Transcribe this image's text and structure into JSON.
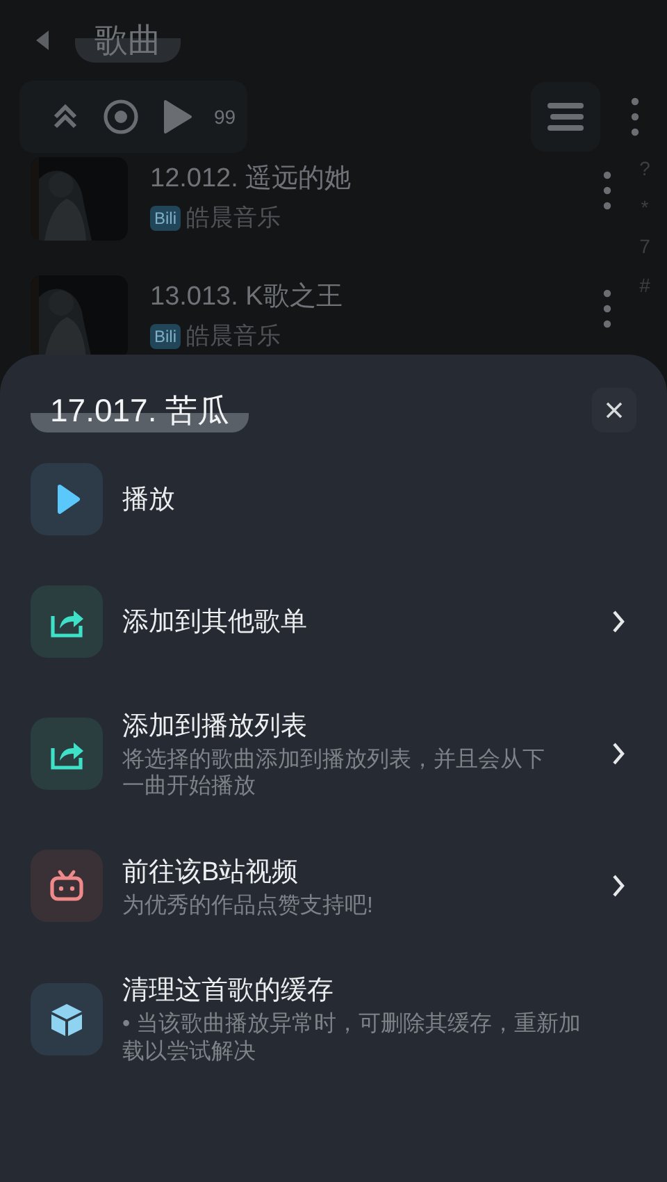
{
  "header": {
    "title": "歌曲"
  },
  "toolbar": {
    "count": "99"
  },
  "songs": [
    {
      "title": "12.012. 遥远的她",
      "badge": "Bili",
      "artist": "皓晨音乐"
    },
    {
      "title": "13.013. K歌之王",
      "badge": "Bili",
      "artist": "皓晨音乐"
    }
  ],
  "index_bar": [
    "?",
    "*",
    "7",
    "#"
  ],
  "sheet": {
    "title": "17.017. 苦瓜",
    "items": [
      {
        "kind": "play",
        "label": "播放",
        "chevron": false
      },
      {
        "kind": "share",
        "label": "添加到其他歌单",
        "chevron": true
      },
      {
        "kind": "share",
        "label": "添加到播放列表",
        "description": "将选择的歌曲添加到播放列表，并且会从下一曲开始播放",
        "chevron": true
      },
      {
        "kind": "bili",
        "label": "前往该B站视频",
        "description": "为优秀的作品点赞支持吧!",
        "chevron": true
      },
      {
        "kind": "cube",
        "label": "清理这首歌的缓存",
        "description": "• 当该歌曲播放异常时，可删除其缓存，重新加载以尝试解决",
        "chevron": false
      }
    ]
  }
}
